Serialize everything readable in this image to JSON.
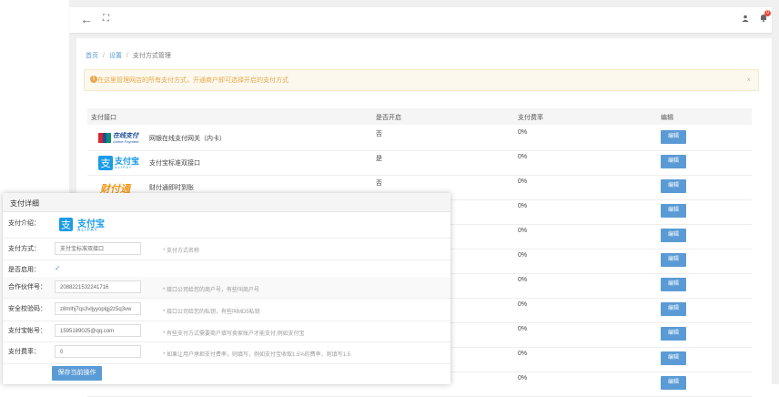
{
  "topbar": {
    "back_icon": "←",
    "fullscreen_icon": "⛶",
    "user_icon": "👤",
    "bell_icon": "🔔",
    "badge_count": "0"
  },
  "breadcrumb": {
    "home": "首页",
    "settings": "设置",
    "current": "支付方式管理"
  },
  "notice": {
    "text": "在这里管理网店的所有支付方式，开通商户即可选择开启的支付方式",
    "close": "×"
  },
  "table": {
    "headers": {
      "name": "支付接口",
      "enabled": "是否开启",
      "fee": "支付费率",
      "edit": "编辑"
    },
    "rows": [
      {
        "name": "网银在线支付网关（内卡）",
        "enabled": "否",
        "fee": "0%",
        "edit": "编辑",
        "logo": "unionpay-online"
      },
      {
        "name": "支付宝标准双接口",
        "enabled": "是",
        "fee": "0%",
        "edit": "编辑",
        "logo": "alipay"
      },
      {
        "name": "财付通即时到账",
        "enabled": "否",
        "fee": "0%",
        "edit": "编辑",
        "logo": "tenpay"
      },
      {
        "name": "",
        "enabled": "",
        "fee": "0%",
        "edit": "编辑",
        "logo": ""
      },
      {
        "name": "",
        "enabled": "",
        "fee": "0%",
        "edit": "编辑",
        "logo": ""
      },
      {
        "name": "",
        "enabled": "",
        "fee": "0%",
        "edit": "编辑",
        "logo": ""
      },
      {
        "name": "",
        "enabled": "",
        "fee": "0%",
        "edit": "编辑",
        "logo": ""
      },
      {
        "name": "",
        "enabled": "",
        "fee": "0%",
        "edit": "编辑",
        "logo": ""
      },
      {
        "name": "",
        "enabled": "",
        "fee": "0%",
        "edit": "编辑",
        "logo": ""
      },
      {
        "name": "",
        "enabled": "",
        "fee": "0%",
        "edit": "编辑",
        "logo": ""
      },
      {
        "name": "",
        "enabled": "",
        "fee": "0%",
        "edit": "编辑",
        "logo": ""
      }
    ]
  },
  "modal": {
    "title": "支付详细",
    "intro_label": "支付介绍：",
    "method_label": "支付方式：",
    "method_value": "支付宝标准双接口",
    "method_hint": "* 支付方式名称",
    "enabled_label": "是否启用：",
    "enabled_check": "✓",
    "partner_label": "合作伙伴号：",
    "partner_value": "2088221532241716",
    "partner_hint": "* 接口公司给您的商户号，有些叫商户号",
    "key_label": "安全校验码：",
    "key_value": "z8mlhj7qs3vljyyoplgj2z5q3vw",
    "key_hint": "* 接口公司给您的私钥，有些叫MD5私钥",
    "account_label": "支付宝帐号：",
    "account_value": "1595189025@qq.com",
    "account_hint": "* 有些支付方式需要商户填写卖家账户才能支付,例如支付宝",
    "fee_label": "支付费率：",
    "fee_value": "0",
    "fee_hint": "* 如果让用户承担支付费率，则填写，例如支付宝收取1.5%的费率，则填写1.5",
    "save_label": "保存当前操作"
  },
  "logos": {
    "unionpay_cn": "在线支付",
    "unionpay_en": "Online Payment",
    "alipay_cn": "支付宝",
    "alipay_en": "ALIPAY",
    "tenpay_cn": "财付通"
  },
  "colors": {
    "accent": "#5b9bd5",
    "notice": "#e8a84b",
    "alipay": "#1a9be6",
    "tenpay": "#f29a1b"
  }
}
